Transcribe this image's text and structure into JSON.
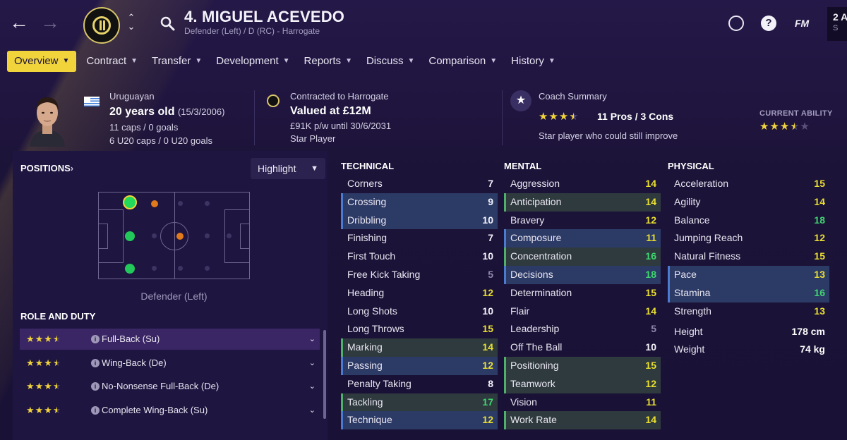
{
  "header": {
    "player_name": "4. MIGUEL ACEVEDO",
    "player_sub": "Defender (Left) / D (RC) - Harrogate",
    "club_badge_text": "HARROGATE TOWN AFC",
    "fm_logo": "FM",
    "date_line1": "2 A",
    "date_line2": "S"
  },
  "tabs": [
    {
      "label": "Overview"
    },
    {
      "label": "Contract"
    },
    {
      "label": "Transfer"
    },
    {
      "label": "Development"
    },
    {
      "label": "Reports"
    },
    {
      "label": "Discuss"
    },
    {
      "label": "Comparison"
    },
    {
      "label": "History"
    }
  ],
  "info": {
    "nationality": "Uruguayan",
    "age": "20 years old",
    "dob": "(15/3/2006)",
    "caps": "11 caps / 0 goals",
    "u20": "6 U20 caps / 0 U20 goals",
    "contract_label": "Contracted to Harrogate",
    "value": "Valued at £12M",
    "wage": "£91K p/w until 30/6/2031",
    "status": "Star Player",
    "coach_label": "Coach Summary",
    "coach_stars": 3.5,
    "pros_cons": "11 Pros / 3 Cons",
    "coach_note": "Star player who could still improve",
    "ca_label": "CURRENT ABILITY",
    "ca_stars": 3.5
  },
  "positions": {
    "title": "POSITIONS",
    "highlight_label": "Highlight",
    "position_label": "Defender (Left)"
  },
  "roles": {
    "title": "ROLE AND DUTY",
    "items": [
      {
        "name": "Full-Back (Su)",
        "stars": 3.5
      },
      {
        "name": "Wing-Back (De)",
        "stars": 3.5
      },
      {
        "name": "No-Nonsense Full-Back (De)",
        "stars": 3.5
      },
      {
        "name": "Complete Wing-Back (Su)",
        "stars": 3.5
      }
    ]
  },
  "technical": {
    "title": "TECHNICAL",
    "rows": [
      {
        "label": "Corners",
        "value": "7"
      },
      {
        "label": "Crossing",
        "value": "9"
      },
      {
        "label": "Dribbling",
        "value": "10"
      },
      {
        "label": "Finishing",
        "value": "7"
      },
      {
        "label": "First Touch",
        "value": "10"
      },
      {
        "label": "Free Kick Taking",
        "value": "5"
      },
      {
        "label": "Heading",
        "value": "12"
      },
      {
        "label": "Long Shots",
        "value": "10"
      },
      {
        "label": "Long Throws",
        "value": "15"
      },
      {
        "label": "Marking",
        "value": "14"
      },
      {
        "label": "Passing",
        "value": "12"
      },
      {
        "label": "Penalty Taking",
        "value": "8"
      },
      {
        "label": "Tackling",
        "value": "17"
      },
      {
        "label": "Technique",
        "value": "12"
      }
    ]
  },
  "mental": {
    "title": "MENTAL",
    "rows": [
      {
        "label": "Aggression",
        "value": "14"
      },
      {
        "label": "Anticipation",
        "value": "14"
      },
      {
        "label": "Bravery",
        "value": "12"
      },
      {
        "label": "Composure",
        "value": "11"
      },
      {
        "label": "Concentration",
        "value": "16"
      },
      {
        "label": "Decisions",
        "value": "18"
      },
      {
        "label": "Determination",
        "value": "15"
      },
      {
        "label": "Flair",
        "value": "14"
      },
      {
        "label": "Leadership",
        "value": "5"
      },
      {
        "label": "Off The Ball",
        "value": "10"
      },
      {
        "label": "Positioning",
        "value": "15"
      },
      {
        "label": "Teamwork",
        "value": "12"
      },
      {
        "label": "Vision",
        "value": "11"
      },
      {
        "label": "Work Rate",
        "value": "14"
      }
    ]
  },
  "physical": {
    "title": "PHYSICAL",
    "rows": [
      {
        "label": "Acceleration",
        "value": "15"
      },
      {
        "label": "Agility",
        "value": "14"
      },
      {
        "label": "Balance",
        "value": "18"
      },
      {
        "label": "Jumping Reach",
        "value": "12"
      },
      {
        "label": "Natural Fitness",
        "value": "15"
      },
      {
        "label": "Pace",
        "value": "13"
      },
      {
        "label": "Stamina",
        "value": "16"
      },
      {
        "label": "Strength",
        "value": "13"
      }
    ],
    "height_label": "Height",
    "height": "178 cm",
    "weight_label": "Weight",
    "weight": "74 kg"
  },
  "colors": {
    "accent": "#f1d43c",
    "background": "#1c1338",
    "panel": "#1e1540",
    "attr_green": "#3fd66f",
    "attr_yellow": "#e9df2f"
  }
}
